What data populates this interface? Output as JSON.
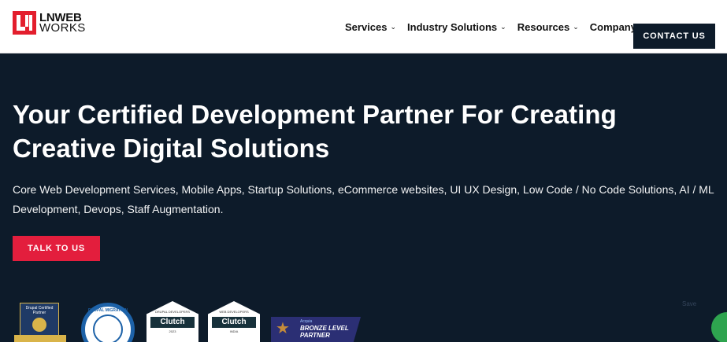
{
  "header": {
    "logo": {
      "line1": "LNWEB",
      "line2": "WORKS"
    },
    "nav": [
      {
        "label": "Services"
      },
      {
        "label": "Industry Solutions"
      },
      {
        "label": "Resources"
      },
      {
        "label": "Company"
      }
    ],
    "contact_label": "CONTACT US"
  },
  "hero": {
    "title": "Your Certified Development Partner For Creating Creative Digital Solutions",
    "description": "Core Web Development Services, Mobile Apps, Startup Solutions, eCommerce websites, UI UX Design, Low Code / No Code Solutions, AI / ML Development, Devops, Staff Augmentation.",
    "cta_label": "TALK TO US"
  },
  "badges": {
    "drupal_certified": "Drupal Certified Partner",
    "drupal_migration": "DRUPAL MIGRATION",
    "clutch1": {
      "top": "DRUPAL DEVELOPERS",
      "name": "Clutch",
      "year": "2023"
    },
    "clutch2": {
      "top": "WEB DEVELOPERS",
      "name": "Clutch",
      "year": "INDIA"
    },
    "acquia": {
      "brand": "Acquia",
      "line1": "BRONZE LEVEL",
      "line2": "PARTNER"
    }
  },
  "save_label": "Save",
  "colors": {
    "navy": "#0d1b2a",
    "red": "#e31e3d",
    "white": "#ffffff"
  }
}
